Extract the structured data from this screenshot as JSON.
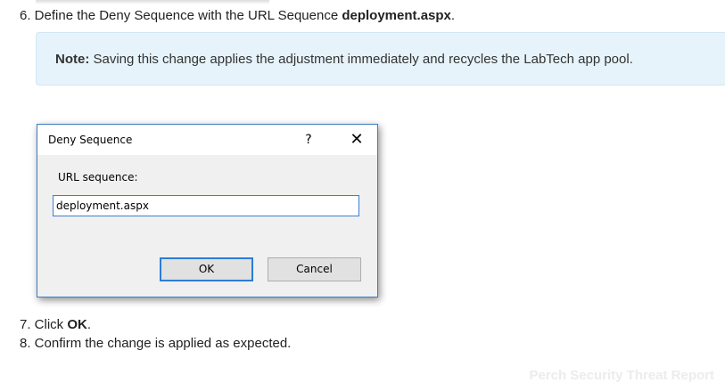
{
  "steps": {
    "step6": {
      "prefix": "6. Define the Deny Sequence with the URL Sequence ",
      "bold": "deployment.aspx",
      "suffix": "."
    },
    "step7": {
      "prefix": "7. Click ",
      "bold": "OK",
      "suffix": "."
    },
    "step8": {
      "text": "8. Confirm the change is applied as expected."
    }
  },
  "note": {
    "label": "Note:",
    "text": " Saving this change applies the adjustment immediately and recycles the LabTech app pool."
  },
  "dialog": {
    "title": "Deny Sequence",
    "help_glyph": "?",
    "close_glyph": "✕",
    "field_label": "URL sequence:",
    "field_value": "deployment.aspx",
    "ok_label": "OK",
    "cancel_label": "Cancel"
  },
  "watermark": "Perch Security Threat Report",
  "colors": {
    "note_background": "#e6f3fb",
    "dialog_border": "#3f7ec0",
    "default_button_border": "#2c7cd6"
  }
}
